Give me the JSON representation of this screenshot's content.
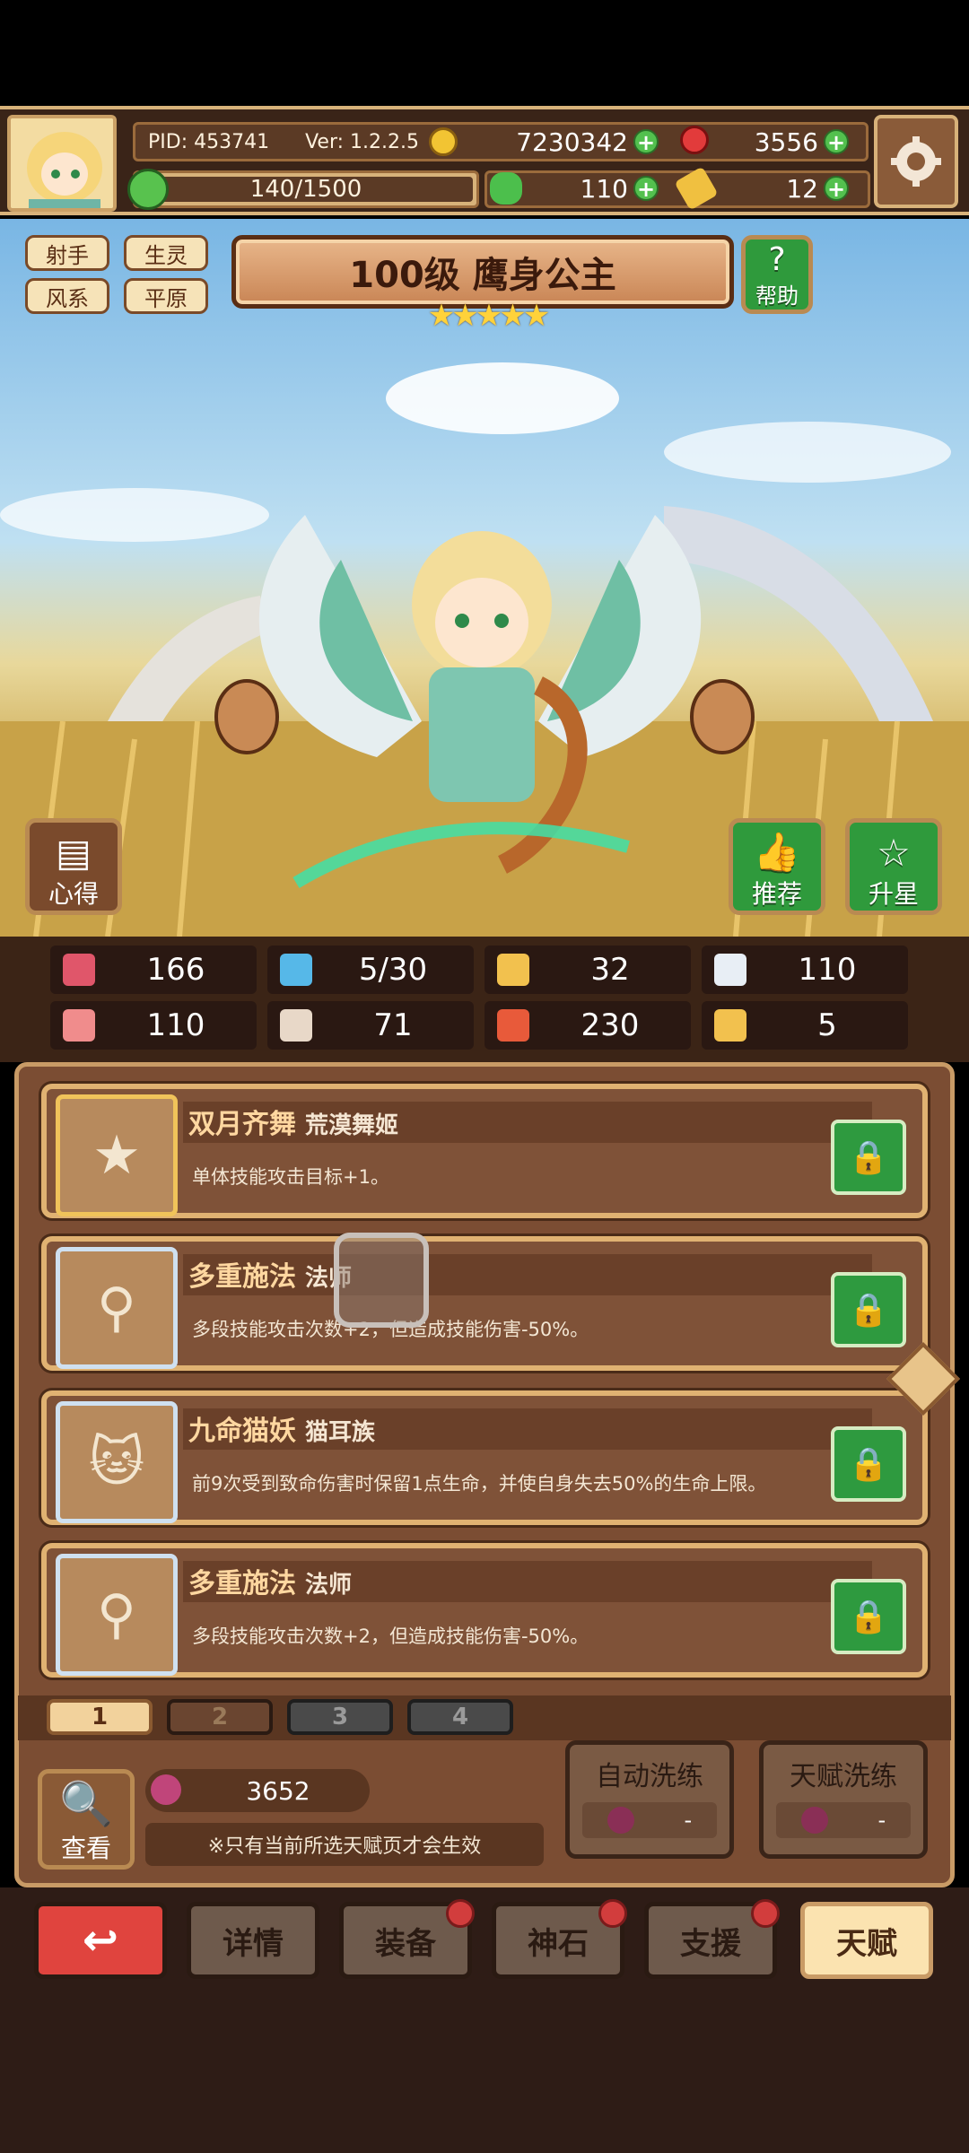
{
  "header": {
    "pid": "PID: 453741",
    "version": "Ver: 1.2.2.5",
    "gold": "7230342",
    "gems": "3556",
    "energy": "140/1500",
    "clover": "110",
    "key": "12"
  },
  "hero": {
    "tags": [
      "射手",
      "生灵",
      "风系",
      "平原"
    ],
    "title": "100级 鹰身公主",
    "stars": "★★★★★",
    "help_label": "帮助",
    "tips_label": "心得",
    "recommend_label": "推荐",
    "star_up_label": "升星"
  },
  "stats": [
    {
      "icon": "heart-icon",
      "value": "166",
      "color": "#e0566a"
    },
    {
      "icon": "water-drop-icon",
      "value": "5/30",
      "color": "#56b8e8"
    },
    {
      "icon": "shield-icon",
      "value": "32",
      "color": "#f2c14e"
    },
    {
      "icon": "wing-icon",
      "value": "110",
      "color": "#e8eef5"
    },
    {
      "icon": "fist-icon",
      "value": "110",
      "color": "#f08c8c"
    },
    {
      "icon": "book-icon",
      "value": "71",
      "color": "#e8d8c8"
    },
    {
      "icon": "spellbook-icon",
      "value": "230",
      "color": "#e85a3a"
    },
    {
      "icon": "horseshoe-icon",
      "value": "5",
      "color": "#f2c14e"
    }
  ],
  "talents": [
    {
      "name": "双月齐舞",
      "source": "荒漠舞姬",
      "desc": "单体技能攻击目标+1。",
      "icon": "star-icon"
    },
    {
      "name": "多重施法",
      "source": "法师",
      "desc": "多段技能攻击次数+2，但造成技能伤害-50%。",
      "icon": "staff-icon"
    },
    {
      "name": "九命猫妖",
      "source": "猫耳族",
      "desc": "前9次受到致命伤害时保留1点生命，并使自身失去50%的生命上限。",
      "icon": "cat-icon"
    },
    {
      "name": "多重施法",
      "source": "法师",
      "desc": "多段技能攻击次数+2，但造成技能伤害-50%。",
      "icon": "staff-icon"
    }
  ],
  "pages": [
    "1",
    "2",
    "3",
    "4"
  ],
  "footer": {
    "view_label": "查看",
    "fruit_count": "3652",
    "note": "※只有当前所选天赋页才会生效",
    "auto_refine_label": "自动洗练",
    "talent_refine_label": "天赋洗练",
    "auto_refine_value": "-",
    "talent_refine_value": "-"
  },
  "nav": {
    "back": "↩",
    "details": "详情",
    "equipment": "装备",
    "godstone": "神石",
    "support": "支援",
    "talent": "天赋"
  }
}
